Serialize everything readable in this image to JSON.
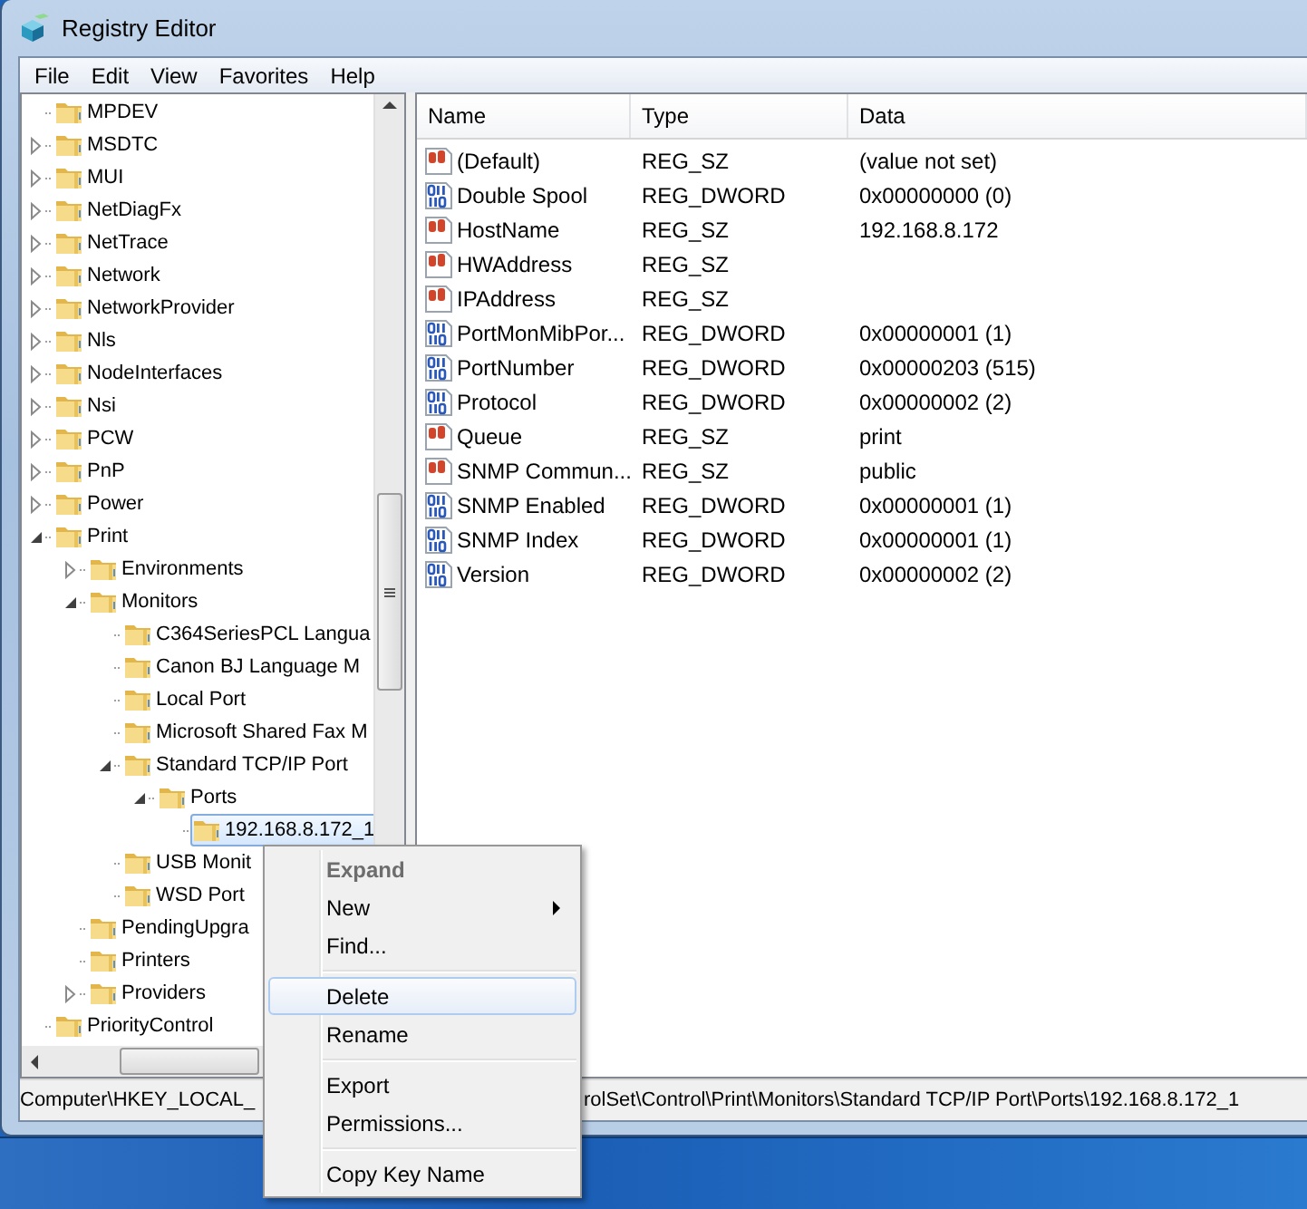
{
  "window": {
    "title": "Registry Editor"
  },
  "menu_bar": [
    "File",
    "Edit",
    "View",
    "Favorites",
    "Help"
  ],
  "tree": [
    {
      "kind": "leaf",
      "label": "MPDEV",
      "selected": false
    },
    {
      "kind": "node",
      "label": "MSDTC",
      "expanded": false,
      "selected": false
    },
    {
      "kind": "node",
      "label": "MUI",
      "expanded": false,
      "selected": false
    },
    {
      "kind": "node",
      "label": "NetDiagFx",
      "expanded": false,
      "selected": false
    },
    {
      "kind": "node",
      "label": "NetTrace",
      "expanded": false,
      "selected": false
    },
    {
      "kind": "node",
      "label": "Network",
      "expanded": false,
      "selected": false
    },
    {
      "kind": "node",
      "label": "NetworkProvider",
      "expanded": false,
      "selected": false
    },
    {
      "kind": "node",
      "label": "Nls",
      "expanded": false,
      "selected": false
    },
    {
      "kind": "node",
      "label": "NodeInterfaces",
      "expanded": false,
      "selected": false
    },
    {
      "kind": "node",
      "label": "Nsi",
      "expanded": false,
      "selected": false
    },
    {
      "kind": "node",
      "label": "PCW",
      "expanded": false,
      "selected": false
    },
    {
      "kind": "node",
      "label": "PnP",
      "expanded": false,
      "selected": false
    },
    {
      "kind": "node",
      "label": "Power",
      "expanded": false,
      "selected": false
    },
    {
      "kind": "node",
      "label": "Print",
      "expanded": true,
      "selected": false,
      "children": [
        {
          "kind": "node",
          "label": "Environments",
          "expanded": false,
          "selected": false
        },
        {
          "kind": "node",
          "label": "Monitors",
          "expanded": true,
          "selected": false,
          "children": [
            {
              "kind": "leaf",
              "label": "C364SeriesPCL Langua",
              "selected": false
            },
            {
              "kind": "leaf",
              "label": "Canon BJ Language M",
              "selected": false
            },
            {
              "kind": "leaf",
              "label": "Local Port",
              "selected": false
            },
            {
              "kind": "leaf",
              "label": "Microsoft Shared Fax M",
              "selected": false
            },
            {
              "kind": "node",
              "label": "Standard TCP/IP Port",
              "expanded": true,
              "selected": false,
              "children": [
                {
                  "kind": "node",
                  "label": "Ports",
                  "expanded": true,
                  "selected": false,
                  "children": [
                    {
                      "kind": "leaf",
                      "label": "192.168.8.172_1",
                      "selected": true
                    }
                  ]
                }
              ]
            },
            {
              "kind": "leaf",
              "label": "USB Monit",
              "selected": false
            },
            {
              "kind": "leaf",
              "label": "WSD Port",
              "selected": false
            }
          ]
        },
        {
          "kind": "leaf",
          "label": "PendingUpgra",
          "selected": false
        },
        {
          "kind": "leaf",
          "label": "Printers",
          "selected": false
        },
        {
          "kind": "node",
          "label": "Providers",
          "expanded": false,
          "selected": false
        }
      ]
    },
    {
      "kind": "leaf",
      "label": "PriorityControl",
      "selected": false
    }
  ],
  "values": {
    "columns": [
      "Name",
      "Type",
      "Data"
    ],
    "rows": [
      {
        "kind": "string",
        "name": "(Default)",
        "type": "REG_SZ",
        "data": "(value not set)"
      },
      {
        "kind": "binary",
        "name": "Double Spool",
        "type": "REG_DWORD",
        "data": "0x00000000 (0)"
      },
      {
        "kind": "string",
        "name": "HostName",
        "type": "REG_SZ",
        "data": "192.168.8.172"
      },
      {
        "kind": "string",
        "name": "HWAddress",
        "type": "REG_SZ"
      },
      {
        "kind": "string",
        "name": "IPAddress",
        "type": "REG_SZ"
      },
      {
        "kind": "binary",
        "name": "PortMonMibPor...",
        "type": "REG_DWORD",
        "data": "0x00000001 (1)"
      },
      {
        "kind": "binary",
        "name": "PortNumber",
        "type": "REG_DWORD",
        "data": "0x00000203 (515)"
      },
      {
        "kind": "binary",
        "name": "Protocol",
        "type": "REG_DWORD",
        "data": "0x00000002 (2)"
      },
      {
        "kind": "string",
        "name": "Queue",
        "type": "REG_SZ",
        "data": "print"
      },
      {
        "kind": "string",
        "name": "SNMP Commun...",
        "type": "REG_SZ",
        "data": "public"
      },
      {
        "kind": "binary",
        "name": "SNMP Enabled",
        "type": "REG_DWORD",
        "data": "0x00000001 (1)"
      },
      {
        "kind": "binary",
        "name": "SNMP Index",
        "type": "REG_DWORD",
        "data": "0x00000001 (1)"
      },
      {
        "kind": "binary",
        "name": "Version",
        "type": "REG_DWORD",
        "data": "0x00000002 (2)"
      }
    ]
  },
  "context_menu": {
    "groups": [
      [
        {
          "label": "Expand",
          "disabled": true,
          "selected": false,
          "submenu": false
        },
        {
          "label": "New",
          "disabled": false,
          "selected": false,
          "submenu": true
        },
        {
          "label": "Find...",
          "disabled": false,
          "selected": false,
          "submenu": false
        }
      ],
      [
        {
          "label": "Delete",
          "disabled": false,
          "selected": true,
          "submenu": false
        },
        {
          "label": "Rename",
          "disabled": false,
          "selected": false,
          "submenu": false
        }
      ],
      [
        {
          "label": "Export",
          "disabled": false,
          "selected": false,
          "submenu": false
        },
        {
          "label": "Permissions...",
          "disabled": false,
          "selected": false,
          "submenu": false
        }
      ],
      [
        {
          "label": "Copy Key Name",
          "disabled": false,
          "selected": false,
          "submenu": false
        }
      ]
    ]
  },
  "status_bar": [
    "Computer\\HKEY_LOCAL_",
    "rolSet\\Control\\Print\\Monitors\\Standard TCP/IP Port\\Ports\\192.168.8.172_1"
  ]
}
